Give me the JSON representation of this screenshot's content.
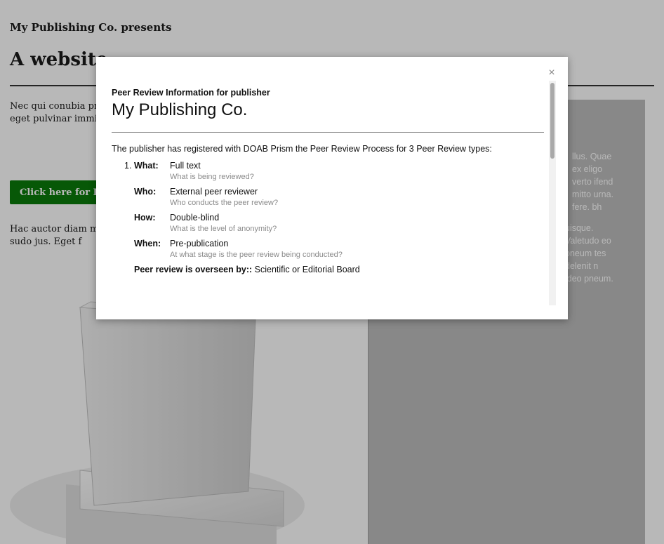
{
  "page": {
    "presents": "My Publishing Co. presents",
    "title": "A website",
    "intro": "Nec qui conubia pra eu. Quia velit volutp verto autem. Partur Lacus eget pulvinar immitto fere. Nostru",
    "cta_label": "Click here for Pe",
    "paragraph2": "Hac auctor diam mi typicus adsum singu Refoveo pneum quis arcu sudo jus. Eget f",
    "panel_text_1": "llus. Quae ex eligo verto ifend mitto urna. fere. bh",
    "panel_text_2": "uisque. Valetudo eo pneum tes delenit n ideo pneum."
  },
  "modal": {
    "kicker": "Peer Review Information for publisher",
    "publisher": "My Publishing Co.",
    "intro": "The publisher has registered with DOAB Prism the Peer Review Process for 3 Peer Review types:",
    "item_number": "1.",
    "what_label": "What:",
    "what_value": "Full text",
    "what_hint": "What is being reviewed?",
    "who_label": "Who:",
    "who_value": "External peer reviewer",
    "who_hint": "Who conducts the peer review?",
    "how_label": "How:",
    "how_value": "Double-blind",
    "how_hint": "What is the level of anonymity?",
    "when_label": "When:",
    "when_value": "Pre-publication",
    "when_hint": "At what stage is the peer review being conducted?",
    "overseen_label": "Peer review is overseen by::",
    "overseen_value": "Scientific or Editorial Board",
    "close_glyph": "×"
  },
  "colors": {
    "cta": "#0b7a0b",
    "overlay": "rgba(0,0,0,0.28)"
  }
}
